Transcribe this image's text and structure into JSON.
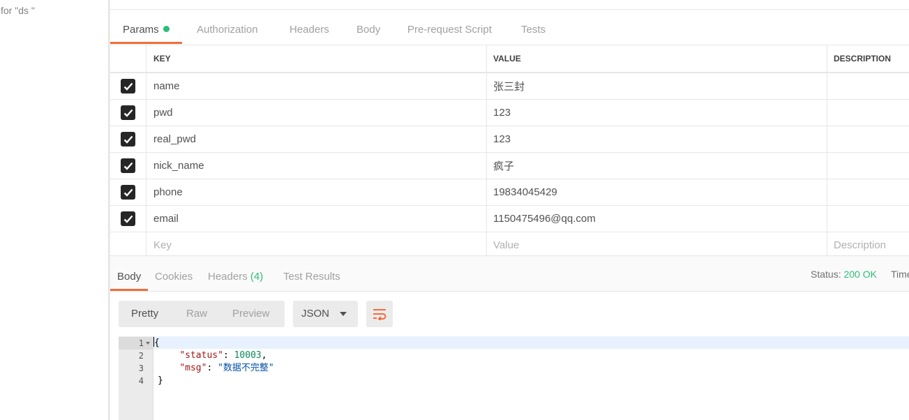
{
  "sidebar": {
    "search_hint": "for \"ds \""
  },
  "request_tabs": [
    {
      "label": "Params",
      "active": true,
      "has_dot": true
    },
    {
      "label": "Authorization"
    },
    {
      "label": "Headers"
    },
    {
      "label": "Body"
    },
    {
      "label": "Pre-request Script"
    },
    {
      "label": "Tests"
    }
  ],
  "params": {
    "headers": {
      "key": "KEY",
      "value": "VALUE",
      "description": "DESCRIPTION"
    },
    "rows": [
      {
        "checked": true,
        "key": "name",
        "value": "张三封"
      },
      {
        "checked": true,
        "key": "pwd",
        "value": "123"
      },
      {
        "checked": true,
        "key": "real_pwd",
        "value": "123"
      },
      {
        "checked": true,
        "key": "nick_name",
        "value": "疯子"
      },
      {
        "checked": true,
        "key": "phone",
        "value": "19834045429"
      },
      {
        "checked": true,
        "key": "email",
        "value": "1150475496@qq.com"
      }
    ],
    "placeholders": {
      "key": "Key",
      "value": "Value",
      "description": "Description"
    }
  },
  "response": {
    "tabs": {
      "body": "Body",
      "cookies": "Cookies",
      "headers": "Headers",
      "headers_count": "(4)",
      "test_results": "Test Results"
    },
    "status_label": "Status:",
    "status_value": "200 OK",
    "time_label": "Time"
  },
  "viewer": {
    "formats": [
      "Pretty",
      "Raw",
      "Preview"
    ],
    "active_format": "Pretty",
    "language": "JSON"
  },
  "code": {
    "line_numbers": [
      "1",
      "2",
      "3",
      "4"
    ],
    "open_brace": "{",
    "close_brace": "}",
    "status_key": "\"status\"",
    "status_value": "10003",
    "msg_key": "\"msg\"",
    "msg_value": "\"数据不完整\""
  },
  "colors": {
    "accent": "#f26b3a",
    "success": "#2ebc7a"
  }
}
